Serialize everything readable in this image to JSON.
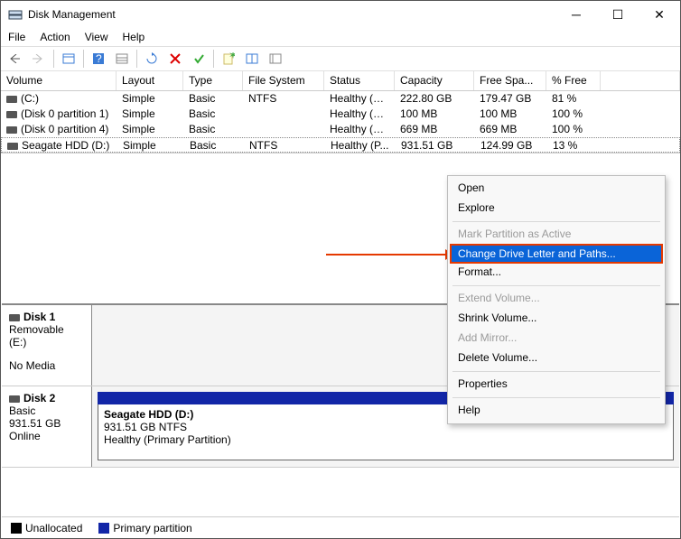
{
  "window": {
    "title": "Disk Management"
  },
  "menus": {
    "file": "File",
    "action": "Action",
    "view": "View",
    "help": "Help"
  },
  "columns": {
    "volume": "Volume",
    "layout": "Layout",
    "type": "Type",
    "fs": "File System",
    "status": "Status",
    "capacity": "Capacity",
    "free": "Free Spa...",
    "pct": "% Free"
  },
  "rows": [
    {
      "vol": "(C:)",
      "lay": "Simple",
      "typ": "Basic",
      "fs": "NTFS",
      "st": "Healthy (B...",
      "cap": "222.80 GB",
      "free": "179.47 GB",
      "pct": "81 %"
    },
    {
      "vol": "(Disk 0 partition 1)",
      "lay": "Simple",
      "typ": "Basic",
      "fs": "",
      "st": "Healthy (E...",
      "cap": "100 MB",
      "free": "100 MB",
      "pct": "100 %"
    },
    {
      "vol": "(Disk 0 partition 4)",
      "lay": "Simple",
      "typ": "Basic",
      "fs": "",
      "st": "Healthy (R...",
      "cap": "669 MB",
      "free": "669 MB",
      "pct": "100 %"
    },
    {
      "vol": "Seagate HDD (D:)",
      "lay": "Simple",
      "typ": "Basic",
      "fs": "NTFS",
      "st": "Healthy (P...",
      "cap": "931.51 GB",
      "free": "124.99 GB",
      "pct": "13 %"
    }
  ],
  "disk1": {
    "name": "Disk 1",
    "removable": "Removable (E:)",
    "nomedia": "No Media"
  },
  "disk2": {
    "name": "Disk 2",
    "kind": "Basic",
    "size": "931.51 GB",
    "state": "Online",
    "part_title": "Seagate HDD  (D:)",
    "part_size": "931.51 GB NTFS",
    "part_status": "Healthy (Primary Partition)"
  },
  "legend": {
    "unalloc": "Unallocated",
    "primary": "Primary partition"
  },
  "ctx": {
    "open": "Open",
    "explore": "Explore",
    "mark_active": "Mark Partition as Active",
    "change_letter": "Change Drive Letter and Paths...",
    "format": "Format...",
    "extend": "Extend Volume...",
    "shrink": "Shrink Volume...",
    "add_mirror": "Add Mirror...",
    "delete_vol": "Delete Volume...",
    "properties": "Properties",
    "help": "Help"
  }
}
